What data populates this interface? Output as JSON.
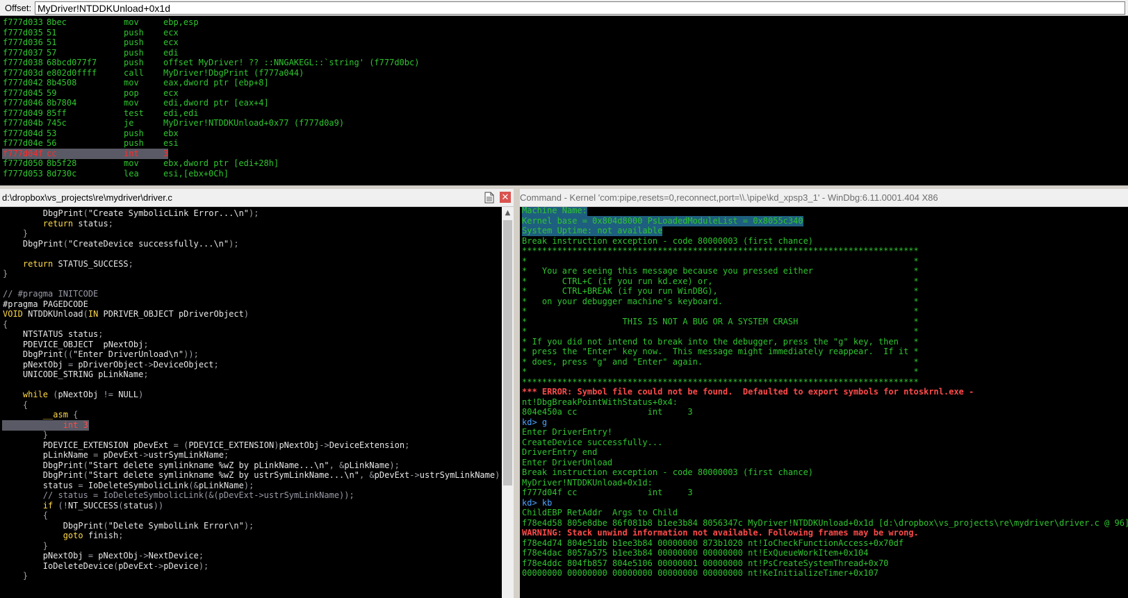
{
  "offset_bar": {
    "label": "Offset:",
    "value": "MyDriver!NTDDKUnload+0x1d"
  },
  "disassembly": [
    {
      "addr": "f777d033",
      "bytes": "8bec",
      "mnem": "mov",
      "ops": "ebp,esp"
    },
    {
      "addr": "f777d035",
      "bytes": "51",
      "mnem": "push",
      "ops": "ecx"
    },
    {
      "addr": "f777d036",
      "bytes": "51",
      "mnem": "push",
      "ops": "ecx"
    },
    {
      "addr": "f777d037",
      "bytes": "57",
      "mnem": "push",
      "ops": "edi"
    },
    {
      "addr": "f777d038",
      "bytes": "68bcd077f7",
      "mnem": "push",
      "ops": "offset MyDriver! ?? ::NNGAKEGL::`string' (f777d0bc)"
    },
    {
      "addr": "f777d03d",
      "bytes": "e802d0ffff",
      "mnem": "call",
      "ops": "MyDriver!DbgPrint (f777a044)"
    },
    {
      "addr": "f777d042",
      "bytes": "8b4508",
      "mnem": "mov",
      "ops": "eax,dword ptr [ebp+8]"
    },
    {
      "addr": "f777d045",
      "bytes": "59",
      "mnem": "pop",
      "ops": "ecx"
    },
    {
      "addr": "f777d046",
      "bytes": "8b7804",
      "mnem": "mov",
      "ops": "edi,dword ptr [eax+4]"
    },
    {
      "addr": "f777d049",
      "bytes": "85ff",
      "mnem": "test",
      "ops": "edi,edi"
    },
    {
      "addr": "f777d04b",
      "bytes": "745c",
      "mnem": "je",
      "ops": "MyDriver!NTDDKUnload+0x77 (f777d0a9)"
    },
    {
      "addr": "f777d04d",
      "bytes": "53",
      "mnem": "push",
      "ops": "ebx"
    },
    {
      "addr": "f777d04e",
      "bytes": "56",
      "mnem": "push",
      "ops": "esi"
    },
    {
      "addr": "f777d04f",
      "bytes": "cc",
      "mnem": "int",
      "ops": "3"
    },
    {
      "addr": "f777d050",
      "bytes": "8b5f28",
      "mnem": "mov",
      "ops": "ebx,dword ptr [edi+28h]"
    },
    {
      "addr": "f777d053",
      "bytes": "8d730c",
      "mnem": "lea",
      "ops": "esi,[ebx+0Ch]"
    }
  ],
  "source": {
    "path": "d:\\dropbox\\vs_projects\\re\\mydriver\\driver.c",
    "lines": [
      "        DbgPrint(\"Create SymbolicLink Error...\\n\");",
      "        return status;",
      "    }",
      "    DbgPrint(\"CreateDevice successfully...\\n\");",
      "",
      "    return STATUS_SUCCESS;",
      "}",
      "",
      "// #pragma INITCODE",
      "#pragma PAGEDCODE",
      "VOID NTDDKUnload(IN PDRIVER_OBJECT pDriverObject)",
      "{",
      "    NTSTATUS status;",
      "    PDEVICE_OBJECT  pNextObj;",
      "    DbgPrint((\"Enter DriverUnload\\n\"));",
      "    pNextObj = pDriverObject->DeviceObject;",
      "    UNICODE_STRING pLinkName;",
      "",
      "    while (pNextObj != NULL)",
      "    {",
      "        __asm {",
      "            int 3",
      "        }",
      "        PDEVICE_EXTENSION pDevExt = (PDEVICE_EXTENSION)pNextObj->DeviceExtension;",
      "        pLinkName = pDevExt->ustrSymLinkName;",
      "        DbgPrint(\"Start delete symlinkname %wZ by pLinkName...\\n\", &pLinkName);",
      "        DbgPrint(\"Start delete symlinkname %wZ by ustrSymLinkName...\\n\", &pDevExt->ustrSymLinkName);",
      "        status = IoDeleteSymbolicLink(&pLinkName);",
      "        // status = IoDeleteSymbolicLink(&(pDevExt->ustrSymLinkName));",
      "        if (!NT_SUCCESS(status))",
      "        {",
      "            DbgPrint(\"Delete SymbolLink Error\\n\");",
      "            goto finish;",
      "        }",
      "        pNextObj = pNextObj->NextDevice;",
      "        IoDeleteDevice(pDevExt->pDevice);",
      "    }"
    ]
  },
  "command": {
    "title": "Command - Kernel 'com:pipe,resets=0,reconnect,port=\\\\.\\pipe\\kd_xpsp3_1' - WinDbg:6.11.0001.404 X86",
    "lines": [
      {
        "t": "Machine Name:",
        "k": "sel"
      },
      {
        "t": "Kernel base = 0x804d8000 PsLoadedModuleList = 0x8055c340",
        "k": "sel"
      },
      {
        "t": "System Uptime: not available",
        "k": "sel"
      },
      {
        "t": "Break instruction exception - code 80000003 (first chance)",
        "k": ""
      },
      {
        "t": "*******************************************************************************",
        "k": ""
      },
      {
        "t": "*                                                                             *",
        "k": ""
      },
      {
        "t": "*   You are seeing this message because you pressed either                    *",
        "k": ""
      },
      {
        "t": "*       CTRL+C (if you run kd.exe) or,                                        *",
        "k": ""
      },
      {
        "t": "*       CTRL+BREAK (if you run WinDBG),                                       *",
        "k": ""
      },
      {
        "t": "*   on your debugger machine's keyboard.                                      *",
        "k": ""
      },
      {
        "t": "*                                                                             *",
        "k": ""
      },
      {
        "t": "*                   THIS IS NOT A BUG OR A SYSTEM CRASH                       *",
        "k": ""
      },
      {
        "t": "*                                                                             *",
        "k": ""
      },
      {
        "t": "* If you did not intend to break into the debugger, press the \"g\" key, then   *",
        "k": ""
      },
      {
        "t": "* press the \"Enter\" key now.  This message might immediately reappear.  If it *",
        "k": ""
      },
      {
        "t": "* does, press \"g\" and \"Enter\" again.                                          *",
        "k": ""
      },
      {
        "t": "*                                                                             *",
        "k": ""
      },
      {
        "t": "*******************************************************************************",
        "k": ""
      },
      {
        "t": "*** ERROR: Symbol file could not be found.  Defaulted to export symbols for ntoskrnl.exe -",
        "k": "err"
      },
      {
        "t": "nt!DbgBreakPointWithStatus+0x4:",
        "k": ""
      },
      {
        "t": "804e450a cc              int     3",
        "k": ""
      },
      {
        "t": "kd> g",
        "k": "prm"
      },
      {
        "t": "Enter DriverEntry!",
        "k": ""
      },
      {
        "t": "CreateDevice successfully...",
        "k": ""
      },
      {
        "t": "DriverEntry end",
        "k": ""
      },
      {
        "t": "Enter DriverUnload",
        "k": ""
      },
      {
        "t": "Break instruction exception - code 80000003 (first chance)",
        "k": ""
      },
      {
        "t": "MyDriver!NTDDKUnload+0x1d:",
        "k": ""
      },
      {
        "t": "f777d04f cc              int     3",
        "k": ""
      },
      {
        "t": "kd> kb",
        "k": "prm"
      },
      {
        "t": "ChildEBP RetAddr  Args to Child",
        "k": ""
      },
      {
        "t": "f78e4d58 805e8dbe 86f081b8 b1ee3b84 8056347c MyDriver!NTDDKUnload+0x1d [d:\\dropbox\\vs_projects\\re\\mydriver\\driver.c @ 96]",
        "k": ""
      },
      {
        "t": "WARNING: Stack unwind information not available. Following frames may be wrong.",
        "k": "err"
      },
      {
        "t": "f78e4d74 804e51db b1ee3b84 00000000 873b1020 nt!IoCheckFunctionAccess+0x70df",
        "k": ""
      },
      {
        "t": "f78e4dac 8057a575 b1ee3b84 00000000 00000000 nt!ExQueueWorkItem+0x104",
        "k": ""
      },
      {
        "t": "f78e4ddc 804fb857 804e5106 00000001 00000000 nt!PsCreateSystemThread+0x70",
        "k": ""
      },
      {
        "t": "00000000 00000000 00000000 00000000 00000000 nt!KeInitializeTimer+0x107",
        "k": ""
      }
    ]
  },
  "colors": {
    "green": "#2fc52f",
    "error": "#ff4a4a",
    "prompt": "#4da3ff",
    "keyword": "#ffd84a"
  },
  "icons": {
    "doc": "document-icon",
    "close": "close-icon",
    "scroll_up": "scroll-up-arrow-icon"
  }
}
